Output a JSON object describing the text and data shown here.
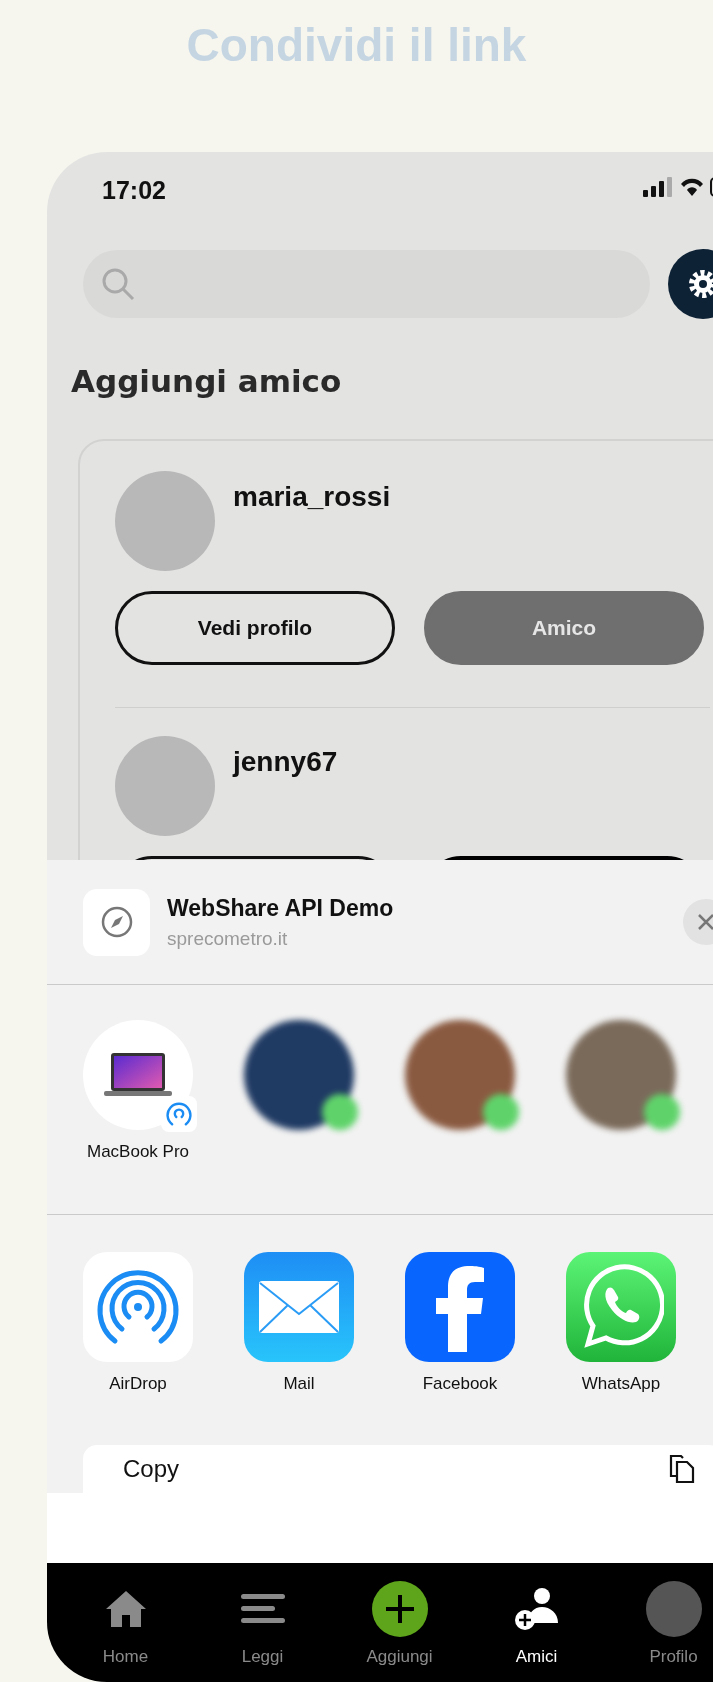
{
  "heading": "Condividi il link",
  "status_bar": {
    "time": "17:02"
  },
  "section_title": "Aggiungi amico",
  "friends": [
    {
      "username": "maria_rossi",
      "buttons": [
        {
          "kind": "outline",
          "label": "Vedi profilo"
        },
        {
          "kind": "muted",
          "label": "Amico"
        }
      ]
    },
    {
      "username": "jenny67",
      "buttons": [
        {
          "kind": "outline"
        },
        {
          "kind": "filled"
        }
      ]
    }
  ],
  "share_sheet": {
    "title": "WebShare API Demo",
    "subtitle": "sprecometro.it",
    "targets": [
      {
        "kind": "device",
        "label": "MacBook Pro"
      },
      {
        "kind": "contact",
        "color": "#1f3a63"
      },
      {
        "kind": "contact",
        "color": "#8a5a40"
      },
      {
        "kind": "contact",
        "color": "#7a6a5a"
      }
    ],
    "apps": [
      {
        "kind": "airdrop",
        "label": "AirDrop"
      },
      {
        "kind": "mail",
        "label": "Mail"
      },
      {
        "kind": "facebook",
        "label": "Facebook"
      },
      {
        "kind": "whatsapp",
        "label": "WhatsApp"
      }
    ],
    "actions": [
      {
        "label": "Copy"
      }
    ]
  },
  "tab_bar": [
    {
      "kind": "home",
      "label": "Home",
      "selected": false
    },
    {
      "kind": "read",
      "label": "Leggi",
      "selected": false
    },
    {
      "kind": "add",
      "label": "Aggiungi",
      "selected": false
    },
    {
      "kind": "friends",
      "label": "Amici",
      "selected": true
    },
    {
      "kind": "profile",
      "label": "Profilo",
      "selected": false
    }
  ]
}
